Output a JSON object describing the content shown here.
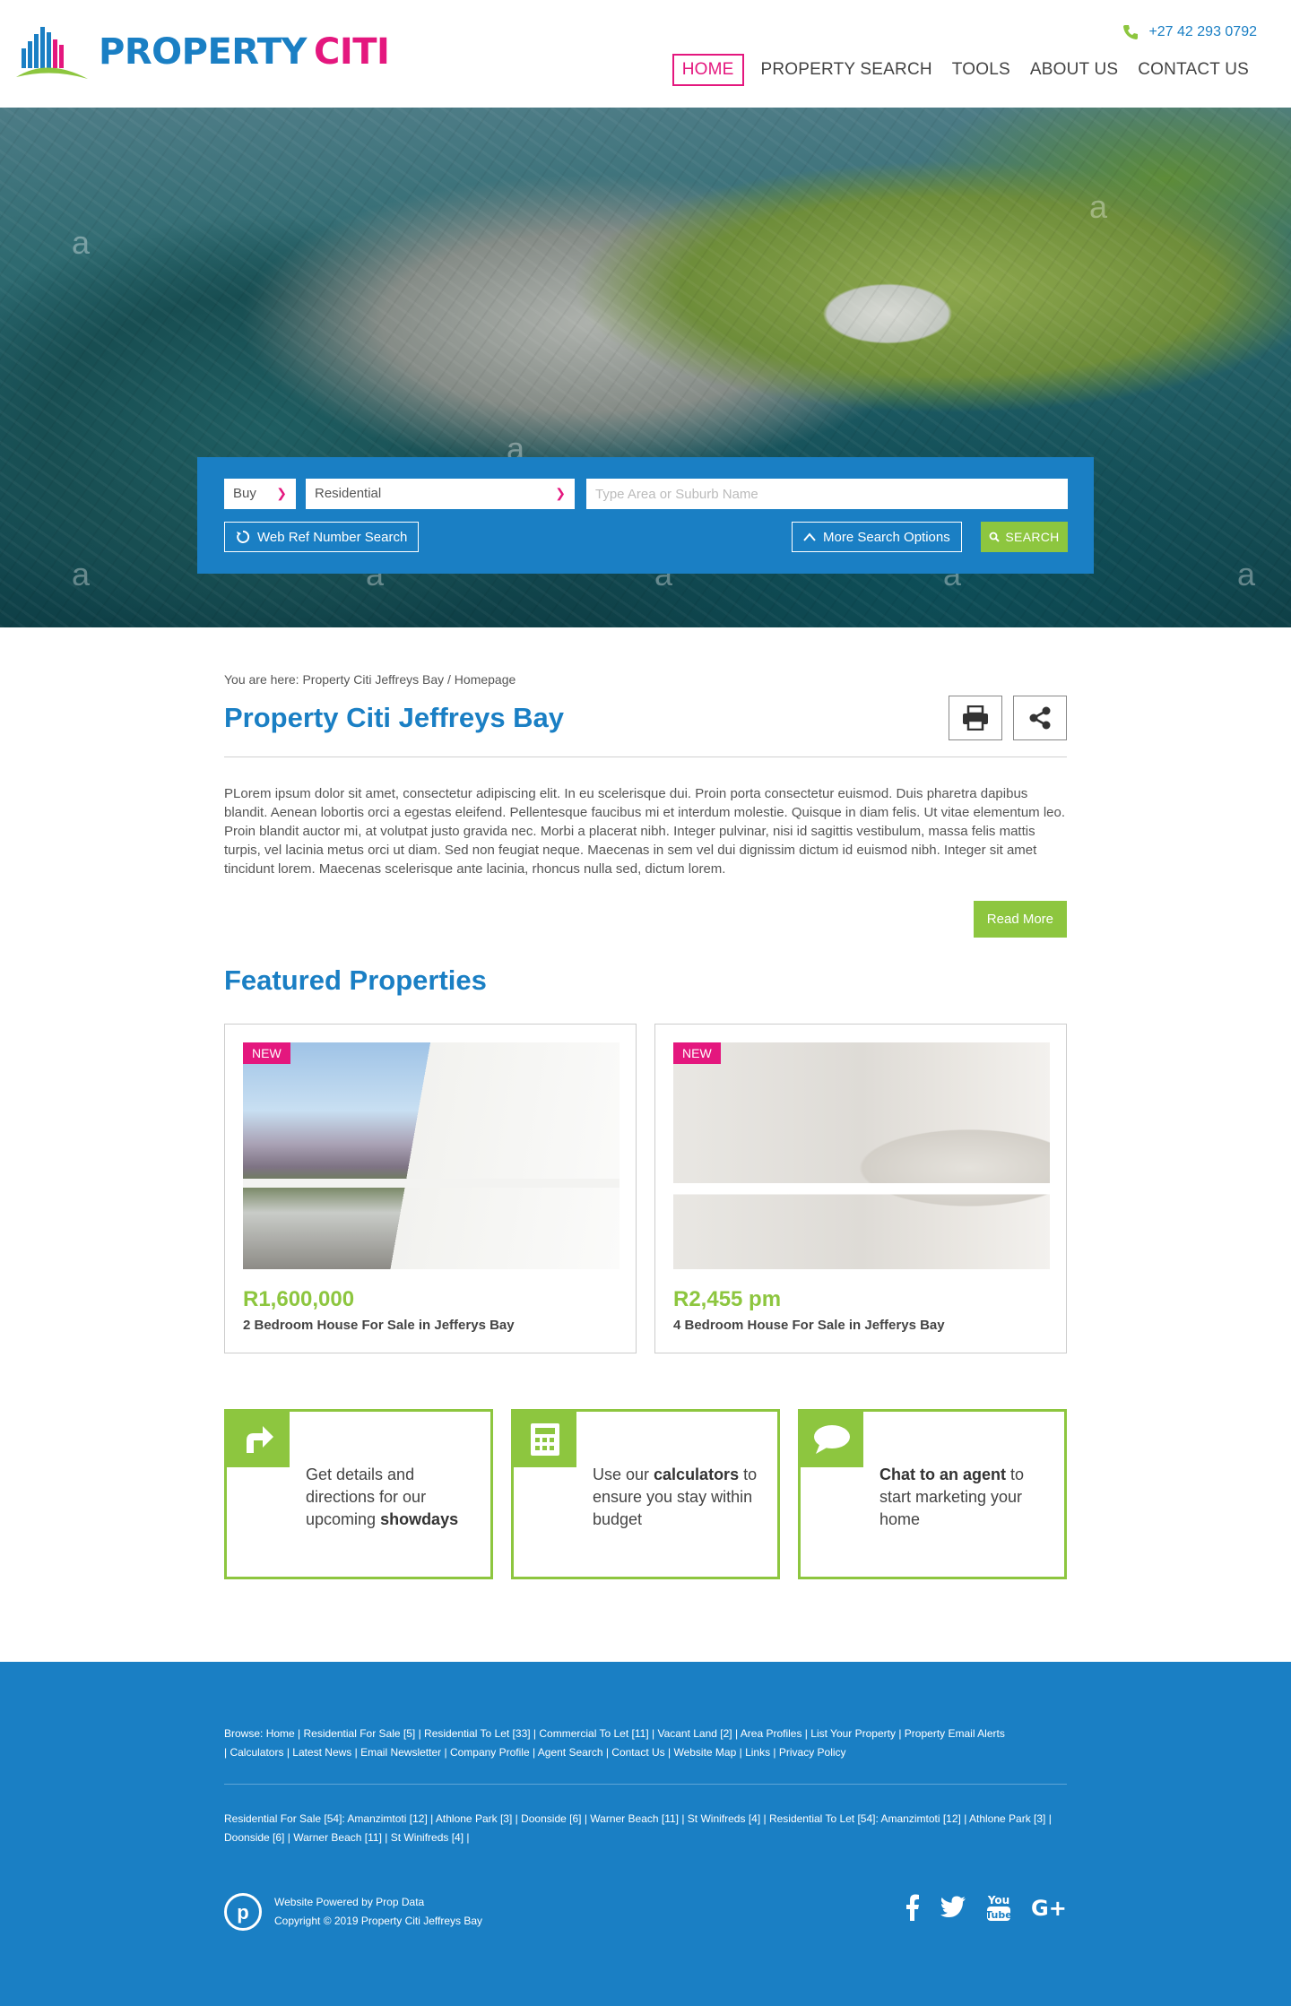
{
  "brand": {
    "part1": "PROPERTY",
    "part2": "CITI",
    "primary_color": "#1a7fc4",
    "accent_color": "#e4177e",
    "green_color": "#8dc63f"
  },
  "header": {
    "phone": "+27 42 293 0792"
  },
  "nav": {
    "items": [
      {
        "label": "HOME",
        "active": true
      },
      {
        "label": "PROPERTY SEARCH"
      },
      {
        "label": "TOOLS"
      },
      {
        "label": "ABOUT US"
      },
      {
        "label": "CONTACT US"
      }
    ]
  },
  "hero": {
    "watermark": "a"
  },
  "search": {
    "listing_type": "Buy",
    "property_type": "Residential",
    "area_placeholder": "Type Area or Suburb Name",
    "web_ref_label": "Web Ref Number Search",
    "more_options_label": "More Search Options",
    "search_label": "SEARCH"
  },
  "breadcrumb": "You are here: Property Citi Jeffreys Bay / Homepage",
  "page_title": "Property Citi Jeffreys Bay",
  "intro": "PLorem ipsum dolor sit amet, consectetur adipiscing elit. In eu scelerisque dui. Proin porta consectetur euismod. Duis pharetra dapibus blandit. Aenean lobortis orci a egestas eleifend. Pellentesque faucibus mi et interdum molestie. Quisque in diam felis. Ut vitae elementum leo. Proin blandit auctor mi, at volutpat justo gravida nec. Morbi a placerat nibh. Integer pulvinar, nisi id sagittis vestibulum, massa felis mattis turpis, vel lacinia metus orci ut diam. Sed non feugiat neque. Maecenas in sem vel dui dignissim dictum id euismod nibh. Integer sit amet tincidunt lorem. Maecenas scelerisque ante lacinia, rhoncus nulla sed, dictum lorem.",
  "read_more": "Read More",
  "featured": {
    "title": "Featured Properties",
    "cards": [
      {
        "badge": "NEW",
        "price": "R1,600,000",
        "desc": "2 Bedroom House For Sale in Jefferys Bay"
      },
      {
        "badge": "NEW",
        "price": "R2,455 pm",
        "desc": "4 Bedroom House For Sale in Jefferys Bay"
      }
    ]
  },
  "ctas": [
    {
      "icon": "directions-arrow-icon",
      "pre": "Get details and directions for our upcoming ",
      "bold": "showdays",
      "post": ""
    },
    {
      "icon": "calculator-icon",
      "pre": "Use our ",
      "bold": "calculators",
      "post": " to ensure you stay within budget"
    },
    {
      "icon": "chat-bubble-icon",
      "pre": "",
      "bold": "Chat to an agent",
      "post": " to start marketing your home"
    }
  ],
  "footer": {
    "browse_prefix": "Browse:",
    "browse_links": [
      "Home",
      "Residential For Sale [5]",
      "Residential To Let [33]",
      "Commercial To Let [11]",
      "Vacant Land [2]",
      "Area Profiles",
      "List Your Property",
      "Property Email Alerts",
      "Calculators",
      "Latest News",
      "Email Newsletter",
      "Company Profile",
      "Agent Search",
      "Contact Us",
      "Website Map",
      "Links",
      "Privacy Policy"
    ],
    "area_links": [
      "Residential For Sale [54]: Amanzimtoti [12]",
      "Athlone Park [3]",
      "Doonside [6]",
      "Warner Beach [11]",
      "St Winifreds [4]",
      "Residential To Let [54]: Amanzimtoti [12]",
      "Athlone Park [3]",
      "Doonside [6]",
      "Warner Beach [11]",
      "St Winifreds [4]"
    ],
    "powered": "Website Powered by Prop Data",
    "copyright": "Copyright © 2019 Property Citi Jeffreys Bay",
    "socials": [
      {
        "icon": "facebook-icon",
        "glyph": "f"
      },
      {
        "icon": "twitter-icon",
        "glyph": "🐦"
      },
      {
        "icon": "youtube-icon",
        "glyph": "You Tube"
      },
      {
        "icon": "google-plus-icon",
        "glyph": "G+"
      }
    ]
  }
}
